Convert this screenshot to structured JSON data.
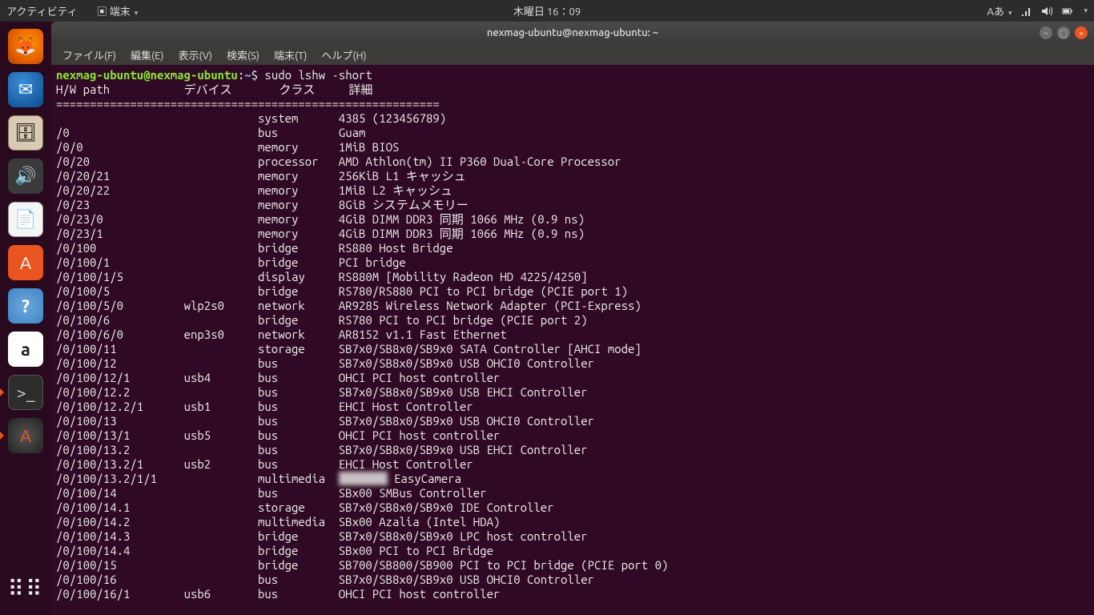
{
  "topbar": {
    "activities": "アクティビティ",
    "app_indicator": "端末",
    "clock": "木曜日 16：09",
    "input_method": "Aあ"
  },
  "window": {
    "title": "nexmag-ubuntu@nexmag-ubuntu: ~"
  },
  "menubar": {
    "file": "ファイル(F)",
    "edit": "編集(E)",
    "view": "表示(V)",
    "search": "検索(S)",
    "terminal": "端末(T)",
    "help": "ヘルプ(H)"
  },
  "prompt": {
    "user_host": "nexmag-ubuntu@nexmag-ubuntu",
    "colon": ":",
    "path": "~",
    "dollar": "$",
    "command": "sudo lshw -short"
  },
  "lshw": {
    "header": {
      "hw_path": "H/W path",
      "device": "デバイス",
      "class": "クラス",
      "detail": "詳細"
    },
    "separator": "=========================================================",
    "rows": [
      {
        "path": "",
        "device": "",
        "class": "system",
        "detail": "4385 (123456789)"
      },
      {
        "path": "/0",
        "device": "",
        "class": "bus",
        "detail": "Guam"
      },
      {
        "path": "/0/0",
        "device": "",
        "class": "memory",
        "detail": "1MiB BIOS"
      },
      {
        "path": "/0/20",
        "device": "",
        "class": "processor",
        "detail": "AMD Athlon(tm) II P360 Dual-Core Processor"
      },
      {
        "path": "/0/20/21",
        "device": "",
        "class": "memory",
        "detail": "256KiB L1 キャッシュ"
      },
      {
        "path": "/0/20/22",
        "device": "",
        "class": "memory",
        "detail": "1MiB L2 キャッシュ"
      },
      {
        "path": "/0/23",
        "device": "",
        "class": "memory",
        "detail": "8GiB システムメモリー"
      },
      {
        "path": "/0/23/0",
        "device": "",
        "class": "memory",
        "detail": "4GiB DIMM DDR3 同期 1066 MHz (0.9 ns)"
      },
      {
        "path": "/0/23/1",
        "device": "",
        "class": "memory",
        "detail": "4GiB DIMM DDR3 同期 1066 MHz (0.9 ns)"
      },
      {
        "path": "/0/100",
        "device": "",
        "class": "bridge",
        "detail": "RS880 Host Bridge"
      },
      {
        "path": "/0/100/1",
        "device": "",
        "class": "bridge",
        "detail": "PCI bridge"
      },
      {
        "path": "/0/100/1/5",
        "device": "",
        "class": "display",
        "detail": "RS880M [Mobility Radeon HD 4225/4250]"
      },
      {
        "path": "/0/100/5",
        "device": "",
        "class": "bridge",
        "detail": "RS780/RS880 PCI to PCI bridge (PCIE port 1)"
      },
      {
        "path": "/0/100/5/0",
        "device": "wlp2s0",
        "class": "network",
        "detail": "AR9285 Wireless Network Adapter (PCI-Express)"
      },
      {
        "path": "/0/100/6",
        "device": "",
        "class": "bridge",
        "detail": "RS780 PCI to PCI bridge (PCIE port 2)"
      },
      {
        "path": "/0/100/6/0",
        "device": "enp3s0",
        "class": "network",
        "detail": "AR8152 v1.1 Fast Ethernet"
      },
      {
        "path": "/0/100/11",
        "device": "",
        "class": "storage",
        "detail": "SB7x0/SB8x0/SB9x0 SATA Controller [AHCI mode]"
      },
      {
        "path": "/0/100/12",
        "device": "",
        "class": "bus",
        "detail": "SB7x0/SB8x0/SB9x0 USB OHCI0 Controller"
      },
      {
        "path": "/0/100/12/1",
        "device": "usb4",
        "class": "bus",
        "detail": "OHCI PCI host controller"
      },
      {
        "path": "/0/100/12.2",
        "device": "",
        "class": "bus",
        "detail": "SB7x0/SB8x0/SB9x0 USB EHCI Controller"
      },
      {
        "path": "/0/100/12.2/1",
        "device": "usb1",
        "class": "bus",
        "detail": "EHCI Host Controller"
      },
      {
        "path": "/0/100/13",
        "device": "",
        "class": "bus",
        "detail": "SB7x0/SB8x0/SB9x0 USB OHCI0 Controller"
      },
      {
        "path": "/0/100/13/1",
        "device": "usb5",
        "class": "bus",
        "detail": "OHCI PCI host controller"
      },
      {
        "path": "/0/100/13.2",
        "device": "",
        "class": "bus",
        "detail": "SB7x0/SB8x0/SB9x0 USB EHCI Controller"
      },
      {
        "path": "/0/100/13.2/1",
        "device": "usb2",
        "class": "bus",
        "detail": "EHCI Host Controller"
      },
      {
        "path": "/0/100/13.2/1/1",
        "device": "",
        "class": "multimedia",
        "detail": "███████ EasyCamera",
        "blur": true
      },
      {
        "path": "/0/100/14",
        "device": "",
        "class": "bus",
        "detail": "SBx00 SMBus Controller"
      },
      {
        "path": "/0/100/14.1",
        "device": "",
        "class": "storage",
        "detail": "SB7x0/SB8x0/SB9x0 IDE Controller"
      },
      {
        "path": "/0/100/14.2",
        "device": "",
        "class": "multimedia",
        "detail": "SBx00 Azalia (Intel HDA)"
      },
      {
        "path": "/0/100/14.3",
        "device": "",
        "class": "bridge",
        "detail": "SB7x0/SB8x0/SB9x0 LPC host controller"
      },
      {
        "path": "/0/100/14.4",
        "device": "",
        "class": "bridge",
        "detail": "SBx00 PCI to PCI Bridge"
      },
      {
        "path": "/0/100/15",
        "device": "",
        "class": "bridge",
        "detail": "SB700/SB800/SB900 PCI to PCI bridge (PCIE port 0)"
      },
      {
        "path": "/0/100/16",
        "device": "",
        "class": "bus",
        "detail": "SB7x0/SB8x0/SB9x0 USB OHCI0 Controller"
      },
      {
        "path": "/0/100/16/1",
        "device": "usb6",
        "class": "bus",
        "detail": "OHCI PCI host controller"
      }
    ]
  }
}
